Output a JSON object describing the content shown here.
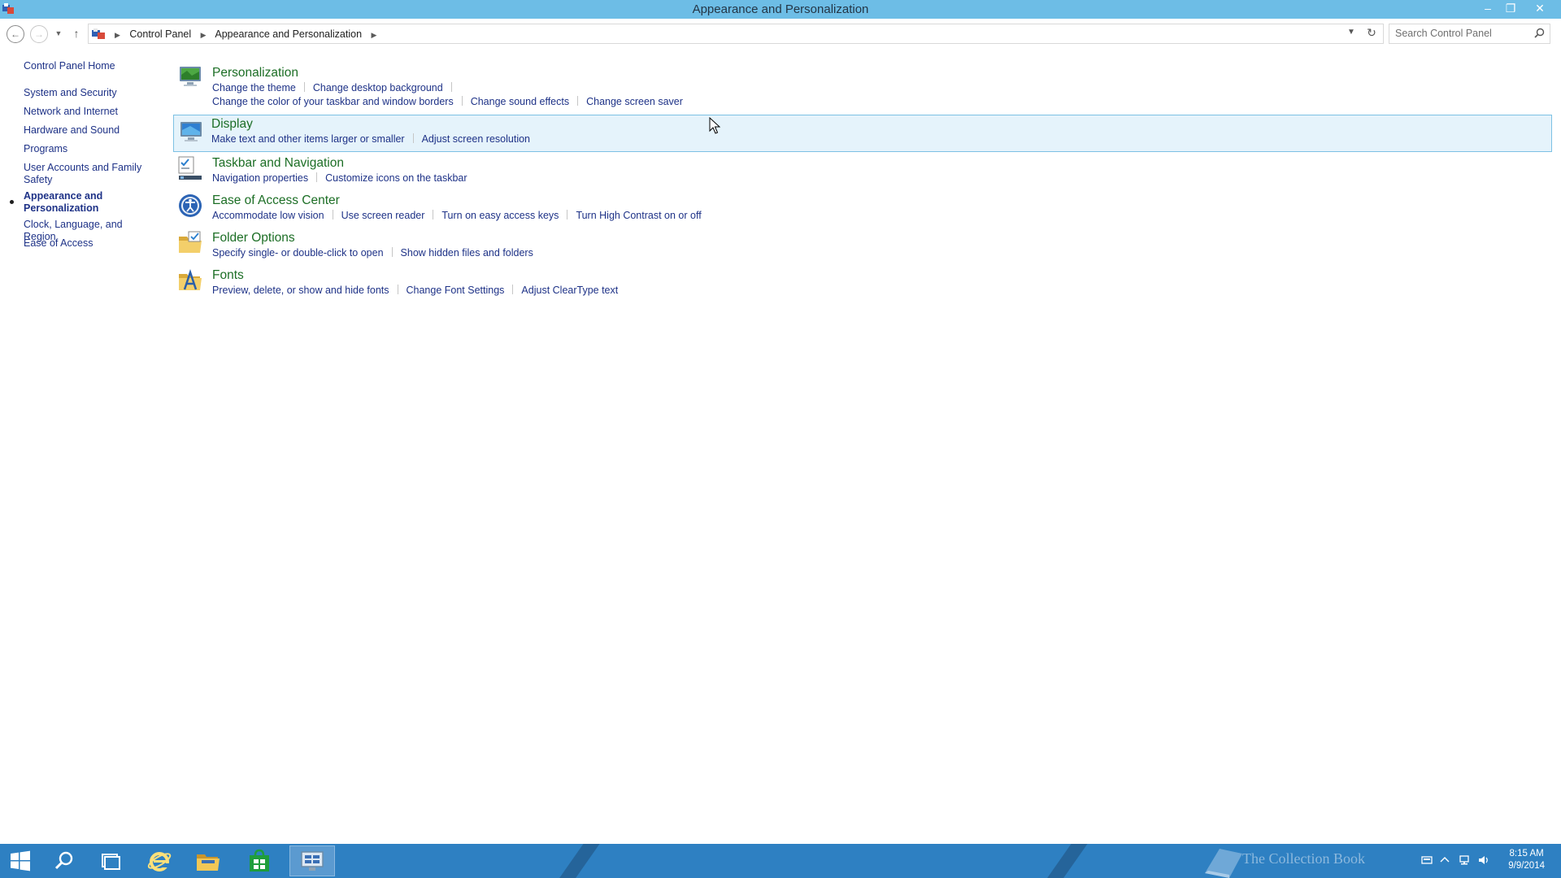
{
  "window": {
    "title": "Appearance and Personalization",
    "minimize": "–",
    "maximize": "❐",
    "close": "✕"
  },
  "address": {
    "crumbs": [
      "Control Panel",
      "Appearance and Personalization"
    ],
    "search_placeholder": "Search Control Panel"
  },
  "sidebar": {
    "home": "Control Panel Home",
    "items": [
      {
        "label": "System and Security"
      },
      {
        "label": "Network and Internet"
      },
      {
        "label": "Hardware and Sound"
      },
      {
        "label": "Programs"
      },
      {
        "label": "User Accounts and Family Safety"
      },
      {
        "label": "Appearance and Personalization"
      },
      {
        "label": "Clock, Language, and Region"
      },
      {
        "label": "Ease of Access"
      }
    ]
  },
  "categories": [
    {
      "title": "Personalization",
      "icon": "personalization-icon",
      "links": [
        "Change the theme",
        "Change desktop background"
      ],
      "links2": [
        "Change the color of your taskbar and window borders",
        "Change sound effects",
        "Change screen saver"
      ]
    },
    {
      "title": "Display",
      "icon": "display-icon",
      "links": [
        "Make text and other items larger or smaller",
        "Adjust screen resolution"
      ]
    },
    {
      "title": "Taskbar and Navigation",
      "icon": "taskbar-icon",
      "links": [
        "Navigation properties",
        "Customize icons on the taskbar"
      ]
    },
    {
      "title": "Ease of Access Center",
      "icon": "ease-of-access-icon",
      "links": [
        "Accommodate low vision",
        "Use screen reader",
        "Turn on easy access keys",
        "Turn High Contrast on or off"
      ]
    },
    {
      "title": "Folder Options",
      "icon": "folder-options-icon",
      "links": [
        "Specify single- or double-click to open",
        "Show hidden files and folders"
      ]
    },
    {
      "title": "Fonts",
      "icon": "fonts-icon",
      "links": [
        "Preview, delete, or show and hide fonts",
        "Change Font Settings",
        "Adjust ClearType text"
      ]
    }
  ],
  "taskbar": {
    "clock_time": "8:15 AM",
    "clock_date": "9/9/2014",
    "watermark": "The Collection Book"
  },
  "colors": {
    "titlebar": "#6dbde6",
    "taskbar": "#2e80c2",
    "link": "#1e3287",
    "heading": "#1c6e25",
    "highlight": "#e5f3fb"
  }
}
